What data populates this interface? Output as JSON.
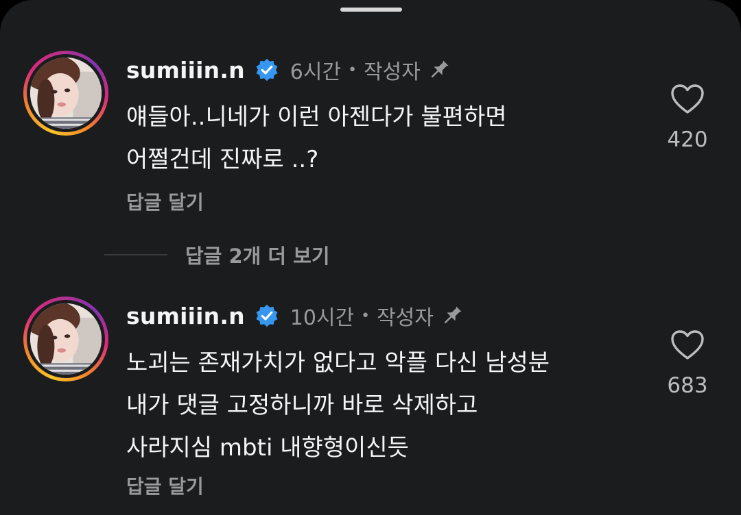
{
  "colors": {
    "background": "#1b1c1e",
    "primary_text": "#f5f5f5",
    "secondary_text": "#9a9a9a",
    "verified_blue": "#3797f0"
  },
  "view_replies_label": "답글 2개 더 보기",
  "comments": [
    {
      "username": "sumiiin.n",
      "time": "6시간",
      "author_tag": "작성자",
      "verified_icon": "verified-badge-icon",
      "pin_icon": "pin-icon",
      "lines": [
        "얘들아..니네가 이런 아젠다가 불편하면",
        "어쩔건데 진짜로 ..?"
      ],
      "reply_label": "답글 달기",
      "likes": "420"
    },
    {
      "username": "sumiiin.n",
      "time": "10시간",
      "author_tag": "작성자",
      "verified_icon": "verified-badge-icon",
      "pin_icon": "pin-icon",
      "lines": [
        "노괴는 존재가치가 없다고 악플 다신 남성분",
        "내가 댓글 고정하니까 바로 삭제하고",
        "사라지심 mbti 내향형이신듯"
      ],
      "reply_label": "답글 달기",
      "likes": "683"
    }
  ]
}
